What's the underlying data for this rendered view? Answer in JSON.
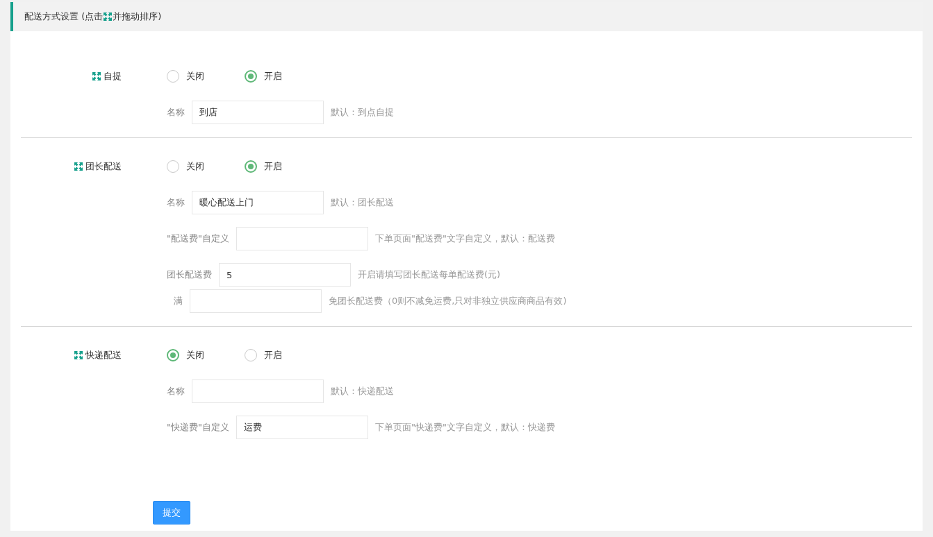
{
  "header": {
    "title_before": "配送方式设置 (点击",
    "title_after": "并拖动排序)"
  },
  "sections": [
    {
      "label": "自提",
      "options": [
        {
          "label": "关闭",
          "selected": false
        },
        {
          "label": "开启",
          "selected": true
        }
      ],
      "fields": [
        {
          "kind": "standard",
          "label": "名称",
          "value": "到店",
          "hint": "默认：到点自提"
        }
      ]
    },
    {
      "label": "团长配送",
      "options": [
        {
          "label": "关闭",
          "selected": false
        },
        {
          "label": "开启",
          "selected": true
        }
      ],
      "fields": [
        {
          "kind": "standard",
          "label": "名称",
          "value": "暖心配送上门",
          "hint": "默认：团长配送"
        },
        {
          "kind": "standard",
          "label": "\"配送费\"自定义",
          "hint": "下单页面\"配送费\"文字自定义，默认：配送费"
        },
        {
          "kind": "standard",
          "label": "团长配送费",
          "value": "5",
          "hint": "开启请填写团长配送每单配送费(元)"
        },
        {
          "kind": "sub",
          "label": "满",
          "hint": "免团长配送费（0则不减免运费,只对非独立供应商商品有效)"
        }
      ]
    },
    {
      "label": "快递配送",
      "options": [
        {
          "label": "关闭",
          "selected": true
        },
        {
          "label": "开启",
          "selected": false
        }
      ],
      "fields": [
        {
          "kind": "standard",
          "label": "名称",
          "hint": "默认：快递配送"
        },
        {
          "kind": "standard",
          "label": "\"快递费\"自定义",
          "value": "运费",
          "hint": "下单页面\"快递费\"文字自定义，默认：快递费"
        }
      ]
    }
  ],
  "submit": {
    "label": "提交"
  }
}
